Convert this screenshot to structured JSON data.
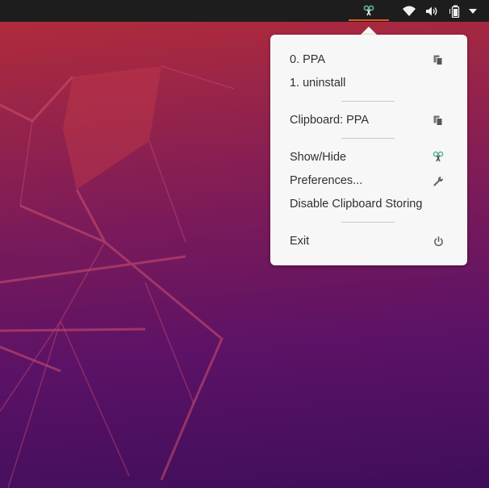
{
  "panel": {
    "indicators": [
      {
        "name": "clipboard-indicator-icon",
        "color": "#5fb79a"
      },
      {
        "name": "wifi-icon"
      },
      {
        "name": "volume-icon"
      },
      {
        "name": "battery-icon"
      },
      {
        "name": "system-menu-chevron-icon"
      }
    ],
    "active_underline_color": "#e95420"
  },
  "menu": {
    "history": [
      {
        "label": "0. PPA",
        "icon": "copy-icon"
      },
      {
        "label": "1. uninstall"
      }
    ],
    "current": {
      "label": "Clipboard: PPA",
      "icon": "copy-icon"
    },
    "actions": [
      {
        "label": "Show/Hide",
        "icon": "clipboard-indicator-icon"
      },
      {
        "label": "Preferences...",
        "icon": "wrench-icon"
      },
      {
        "label": "Disable Clipboard Storing"
      }
    ],
    "exit": {
      "label": "Exit",
      "icon": "power-icon"
    }
  },
  "colors": {
    "panel_bg": "#1d1d1d",
    "menu_bg": "#f7f7f7",
    "menu_text": "#303030",
    "wallpaper_top": "#b62c37",
    "wallpaper_bottom": "#3f0e5b"
  }
}
